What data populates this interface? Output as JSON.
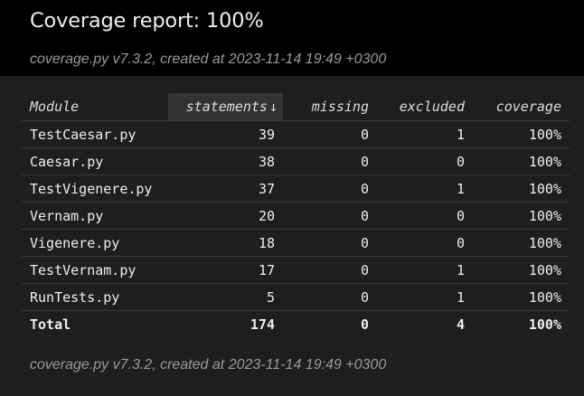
{
  "header": {
    "title": "Coverage report: 100%",
    "subtitle": "coverage.py v7.3.2, created at 2023-11-14 19:49 +0300"
  },
  "table": {
    "columns": {
      "module": "Module",
      "statements": "statements",
      "sort_arrow": "↓",
      "missing": "missing",
      "excluded": "excluded",
      "coverage": "coverage"
    },
    "rows": [
      {
        "module": "TestCaesar.py",
        "statements": "39",
        "missing": "0",
        "excluded": "1",
        "coverage": "100%"
      },
      {
        "module": "Caesar.py",
        "statements": "38",
        "missing": "0",
        "excluded": "0",
        "coverage": "100%"
      },
      {
        "module": "TestVigenere.py",
        "statements": "37",
        "missing": "0",
        "excluded": "1",
        "coverage": "100%"
      },
      {
        "module": "Vernam.py",
        "statements": "20",
        "missing": "0",
        "excluded": "0",
        "coverage": "100%"
      },
      {
        "module": "Vigenere.py",
        "statements": "18",
        "missing": "0",
        "excluded": "0",
        "coverage": "100%"
      },
      {
        "module": "TestVernam.py",
        "statements": "17",
        "missing": "0",
        "excluded": "1",
        "coverage": "100%"
      },
      {
        "module": "RunTests.py",
        "statements": "5",
        "missing": "0",
        "excluded": "1",
        "coverage": "100%"
      }
    ],
    "total": {
      "module": "Total",
      "statements": "174",
      "missing": "0",
      "excluded": "4",
      "coverage": "100%"
    }
  },
  "footer": {
    "text": "coverage.py v7.3.2, created at 2023-11-14 19:49 +0300"
  },
  "colors": {
    "background": "#1e1e1e",
    "header_background": "#000000",
    "sorted_header_background": "#333333",
    "text": "#eeeeee",
    "muted_text": "#9a9a9a"
  }
}
